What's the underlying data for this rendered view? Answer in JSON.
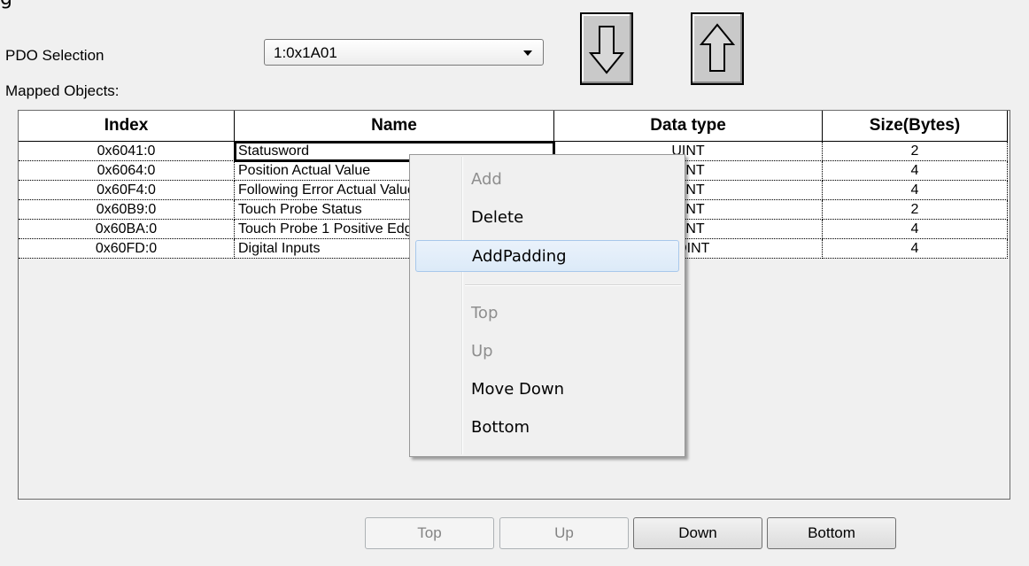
{
  "clipped_top_text": "g",
  "pdo_selection": {
    "label": "PDO Selection",
    "value": "1:0x1A01"
  },
  "mapped_objects_label": "Mapped Objects:",
  "table": {
    "columns": [
      "Index",
      "Name",
      "Data type",
      "Size(Bytes)"
    ],
    "rows": [
      {
        "index": "0x6041:0",
        "name": "Statusword",
        "type": "UINT",
        "size": "2"
      },
      {
        "index": "0x6064:0",
        "name": "Position Actual Value",
        "type": "DINT",
        "size": "4"
      },
      {
        "index": "0x60F4:0",
        "name": "Following Error Actual Value",
        "type": "DINT",
        "size": "4"
      },
      {
        "index": "0x60B9:0",
        "name": "Touch Probe Status",
        "type": "UINT",
        "size": "2"
      },
      {
        "index": "0x60BA:0",
        "name": "Touch Probe 1 Positive Edge",
        "type": "DINT",
        "size": "4"
      },
      {
        "index": "0x60FD:0",
        "name": "Digital Inputs",
        "type": "UDINT",
        "size": "4"
      }
    ]
  },
  "context_menu": {
    "items": [
      {
        "label": "Add",
        "enabled": false
      },
      {
        "label": "Delete",
        "enabled": true
      },
      {
        "label": "AddPadding",
        "enabled": true,
        "highlighted": true
      },
      {
        "label": "Top",
        "enabled": false
      },
      {
        "label": "Up",
        "enabled": false
      },
      {
        "label": "Move Down",
        "enabled": true
      },
      {
        "label": "Bottom",
        "enabled": true
      }
    ]
  },
  "buttons": {
    "top": "Top",
    "up": "Up",
    "down": "Down",
    "bottom": "Bottom"
  }
}
